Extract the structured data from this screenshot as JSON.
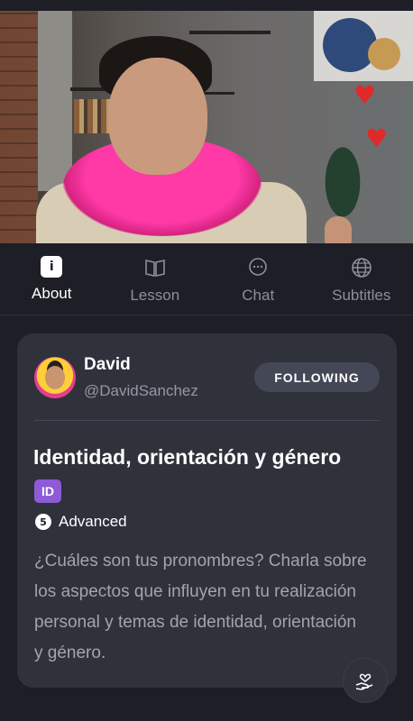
{
  "tabs": [
    {
      "label": "About",
      "icon": "info-icon",
      "active": true
    },
    {
      "label": "Lesson",
      "icon": "book-icon",
      "active": false
    },
    {
      "label": "Chat",
      "icon": "chat-bubble-icon",
      "active": false
    },
    {
      "label": "Subtitles",
      "icon": "globe-icon",
      "active": false
    }
  ],
  "about_icon_text": "i",
  "author": {
    "name": "David",
    "handle": "@DavidSanchez",
    "follow_label": "FOLLOWING"
  },
  "lesson": {
    "title": "Identidad, orientación y género",
    "title_badge": "ID",
    "level_number": "5",
    "level_label": "Advanced",
    "description": "¿Cuáles son tus pronombres? Charla sobre los aspectos que influyen en tu realización personal y temas de identidad, orientación y género."
  },
  "colors": {
    "background": "#1d1e26",
    "card": "#2f313b",
    "accent_badge": "#8e5ad6",
    "boa": "#ff39a6",
    "heart": "#e02a2a"
  }
}
